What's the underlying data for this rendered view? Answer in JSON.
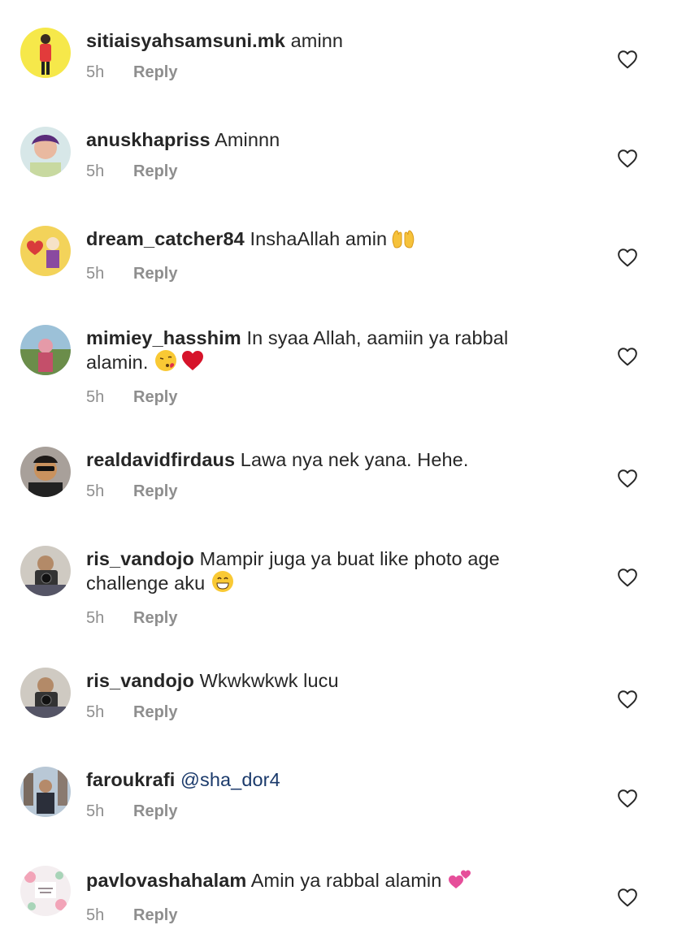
{
  "comments": [
    {
      "username": "sitiaisyahsamsuni.mk",
      "text": "aminn",
      "time": "5h",
      "reply": "Reply",
      "avatar": "avatar-woman-red-top",
      "emoji": []
    },
    {
      "username": "anuskhapriss",
      "text": "Aminnn",
      "time": "5h",
      "reply": "Reply",
      "avatar": "avatar-woman-selfie",
      "emoji": []
    },
    {
      "username": "dream_catcher84",
      "text": "InshaAllah amin",
      "time": "5h",
      "reply": "Reply",
      "avatar": "avatar-cartoon-heart",
      "emoji": [
        "raised-hands-emoji"
      ]
    },
    {
      "username": "mimiey_hasshim",
      "text": "In syaa Allah, aamiin ya rabbal alamin.",
      "time": "5h",
      "reply": "Reply",
      "avatar": "avatar-woman-hijab",
      "emoji": [
        "kiss-face-emoji",
        "red-heart-emoji"
      ]
    },
    {
      "username": "realdavidfirdaus",
      "text": "Lawa nya nek yana. Hehe.",
      "time": "5h",
      "reply": "Reply",
      "avatar": "avatar-man-sunglasses",
      "emoji": []
    },
    {
      "username": "ris_vandojo",
      "text": "Mampir juga ya buat like photo age challenge aku",
      "time": "5h",
      "reply": "Reply",
      "avatar": "avatar-photographer",
      "emoji": [
        "grinning-face-emoji"
      ]
    },
    {
      "username": "ris_vandojo",
      "text": "Wkwkwkwk lucu",
      "time": "5h",
      "reply": "Reply",
      "avatar": "avatar-photographer",
      "emoji": []
    },
    {
      "username": "faroukrafi",
      "text": "@sha_dor4",
      "time": "5h",
      "reply": "Reply",
      "avatar": "avatar-man-city",
      "emoji": [],
      "mention": true
    },
    {
      "username": "pavlovashahalam",
      "text": "Amin ya rabbal alamin",
      "time": "5h",
      "reply": "Reply",
      "avatar": "avatar-pavlova-logo",
      "emoji": [
        "two-hearts-emoji"
      ]
    }
  ],
  "like_icon": "heart-outline-icon",
  "colors": {
    "username": "#262626",
    "meta": "#8e8e8e",
    "mention": "#1b3a6b",
    "background": "#ffffff"
  }
}
